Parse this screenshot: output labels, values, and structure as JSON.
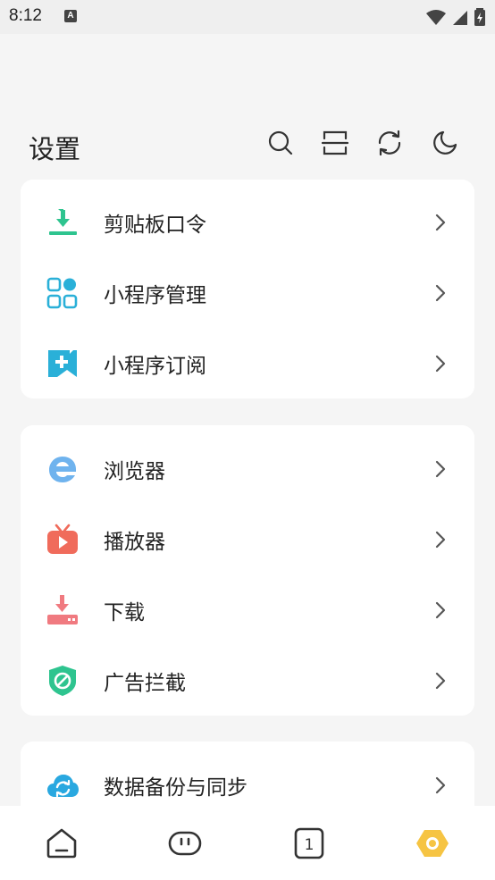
{
  "status_bar": {
    "time": "8:12",
    "notification_badge": "A"
  },
  "header": {
    "title": "设置",
    "icons": [
      "search-icon",
      "scan-icon",
      "sync-icon",
      "night-mode-icon"
    ]
  },
  "groups": [
    {
      "items": [
        {
          "label": "剪贴板口令",
          "icon": "clipboard-download-icon",
          "color": "#2ec48f"
        },
        {
          "label": "小程序管理",
          "icon": "apps-grid-icon",
          "color": "#2ab0d8"
        },
        {
          "label": "小程序订阅",
          "icon": "subscribe-icon",
          "color": "#2ab0d8"
        }
      ]
    },
    {
      "items": [
        {
          "label": "浏览器",
          "icon": "browser-icon",
          "color": "#6fb3ee"
        },
        {
          "label": "播放器",
          "icon": "tv-player-icon",
          "color": "#f06b5b"
        },
        {
          "label": "下载",
          "icon": "download-icon",
          "color": "#f07a80"
        },
        {
          "label": "广告拦截",
          "icon": "ad-block-shield-icon",
          "color": "#2ec48f"
        }
      ]
    },
    {
      "items": [
        {
          "label": "数据备份与同步",
          "icon": "cloud-sync-icon",
          "color": "#29a8e0"
        }
      ]
    }
  ],
  "bottom_nav": {
    "items": [
      "home-icon",
      "assistant-icon",
      "tabs-icon",
      "settings-icon"
    ],
    "tab_count": "1",
    "active_color": "#f6c443"
  }
}
